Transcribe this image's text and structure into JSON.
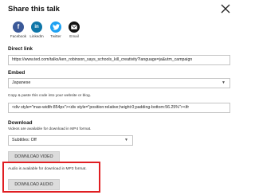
{
  "header": {
    "title": "Share this talk"
  },
  "share": [
    {
      "id": "s-fb",
      "glyph": "f",
      "label": "Facebook",
      "color": "#3b5998",
      "icon": "facebook-icon"
    },
    {
      "id": "s-li",
      "glyph": "in",
      "label": "LinkedIn",
      "color": "#0e76a8",
      "icon": "linkedin-icon"
    },
    {
      "id": "s-tw",
      "glyph": "🐦",
      "label": "Twitter",
      "color": "#1da1f2",
      "icon": "twitter-icon"
    },
    {
      "id": "s-em",
      "glyph": "✉",
      "label": "Email",
      "color": "#111111",
      "icon": "email-icon"
    }
  ],
  "direct_link": {
    "label": "Direct link",
    "value": "https://www.ted.com/talks/ken_robinson_says_schools_kill_creativity?language=ja&utm_campaign"
  },
  "embed": {
    "label": "Embed",
    "language_value": "Japanese",
    "hint": "Copy & paste this code into your website or blog.",
    "code": "<div style=\"max-width:854px\"><div style=\"position:relative;height:0;padding-bottom:56.25%\"><ifr"
  },
  "download": {
    "label": "Download",
    "hint": "Videos are available for download in MP4 format.",
    "subtitles_value": "Subtitles: Off",
    "video_button": "DOWNLOAD VIDEO",
    "audio_hint": "Audio is available for download in MP3 format.",
    "audio_button": "DOWNLOAD AUDIO"
  },
  "colors": {
    "highlight": "#e01e22"
  }
}
